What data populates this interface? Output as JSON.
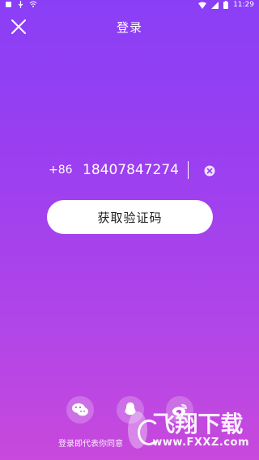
{
  "status_bar": {
    "time": "11:29",
    "icons": [
      "notification-icon",
      "usb-icon",
      "wifi-icon",
      "wifi-signal-icon",
      "cellular-signal-icon",
      "battery-icon"
    ]
  },
  "header": {
    "title": "登录",
    "close_icon": "close-icon"
  },
  "phone": {
    "country_code": "+86",
    "value": "18407847274",
    "clear_icon": "clear-circle-icon"
  },
  "button": {
    "label": "获取验证码"
  },
  "social_login": {
    "wechat_icon": "wechat-icon",
    "qq_icon": "qq-icon",
    "weibo_icon": "weibo-icon"
  },
  "agreement": {
    "text": "登录即代表你同意"
  },
  "watermark": {
    "text": "飞翔下载",
    "url": "www.FXXZ.com"
  }
}
